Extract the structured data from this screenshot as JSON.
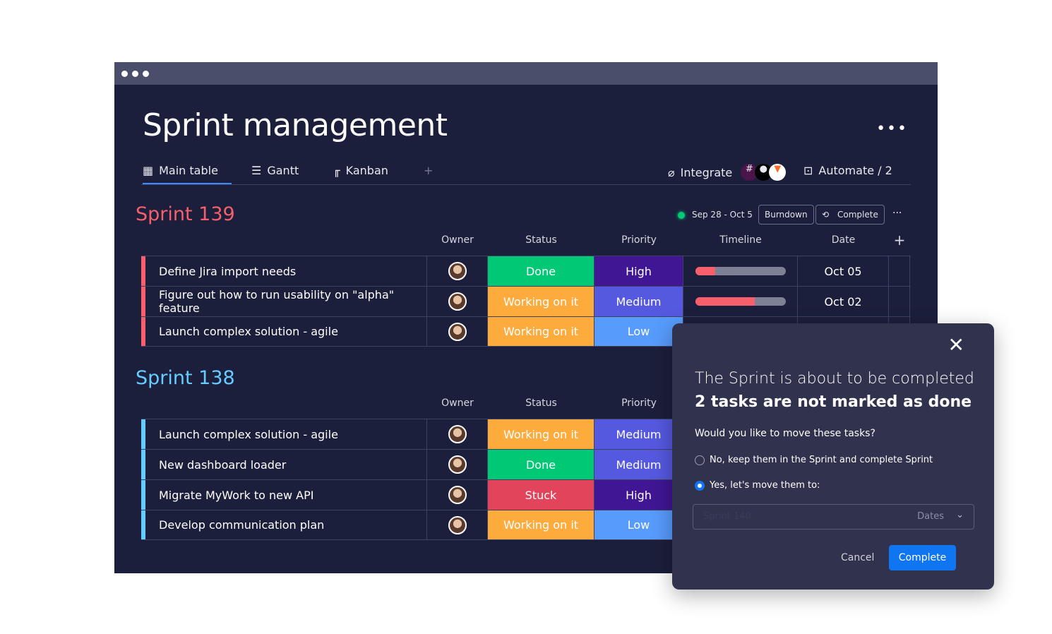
{
  "board": {
    "title": "Sprint management",
    "more": "•••",
    "tabs": [
      {
        "label": "Main table",
        "icon": "table-icon"
      },
      {
        "label": "Gantt",
        "icon": "gantt-icon"
      },
      {
        "label": "Kanban",
        "icon": "kanban-icon"
      }
    ],
    "add_tab": "+",
    "integrate": "Integrate",
    "automate": "Automate / 2"
  },
  "sprint139": {
    "title": "Sprint 139",
    "color": "#f65f6b",
    "dates": "Sep 28 - Oct 5",
    "burndown": "Burndown",
    "complete": "Complete",
    "more": "···",
    "headers": {
      "owner": "Owner",
      "status": "Status",
      "priority": "Priority",
      "timeline": "Timeline",
      "date": "Date",
      "add": "+"
    },
    "rows": [
      {
        "name": "Define Jira import needs",
        "status": "Done",
        "status_color": "#00c875",
        "priority": "High",
        "priority_color": "#401694",
        "timeline_progress": 0.22,
        "date": "Oct 05"
      },
      {
        "name": "Figure out how to run usability on \"alpha\" feature",
        "status": "Working on it",
        "status_color": "#fdab3d",
        "priority": "Medium",
        "priority_color": "#5559df",
        "timeline_progress": 0.66,
        "date": "Oct 02"
      },
      {
        "name": "Launch complex solution - agile",
        "status": "Working on it",
        "status_color": "#fdab3d",
        "priority": "Low",
        "priority_color": "#579bfc"
      }
    ]
  },
  "sprint138": {
    "title": "Sprint 138",
    "color": "#66ccff",
    "headers": {
      "owner": "Owner",
      "status": "Status",
      "priority": "Priority"
    },
    "rows": [
      {
        "name": "Launch complex solution - agile",
        "status": "Working on it",
        "status_color": "#fdab3d",
        "priority": "Medium",
        "priority_color": "#5559df"
      },
      {
        "name": "New dashboard loader",
        "status": "Done",
        "status_color": "#00c875",
        "priority": "Medium",
        "priority_color": "#5559df"
      },
      {
        "name": "Migrate MyWork to new API",
        "status": "Stuck",
        "status_color": "#e2445c",
        "priority": "High",
        "priority_color": "#401694"
      },
      {
        "name": "Develop communication plan",
        "status": "Working on it",
        "status_color": "#fdab3d",
        "priority": "Low",
        "priority_color": "#579bfc"
      }
    ]
  },
  "modal": {
    "line1": "The Sprint is about to be completed",
    "line2": "2 tasks are not marked as done",
    "question": "Would you like to move these tasks?",
    "option_no": "No, keep them in the Sprint and complete Sprint",
    "option_yes": "Yes, let's move them to:",
    "selected": "yes",
    "select_value": "Sprint 140",
    "select_suffix": "Dates",
    "cancel": "Cancel",
    "complete": "Complete"
  }
}
